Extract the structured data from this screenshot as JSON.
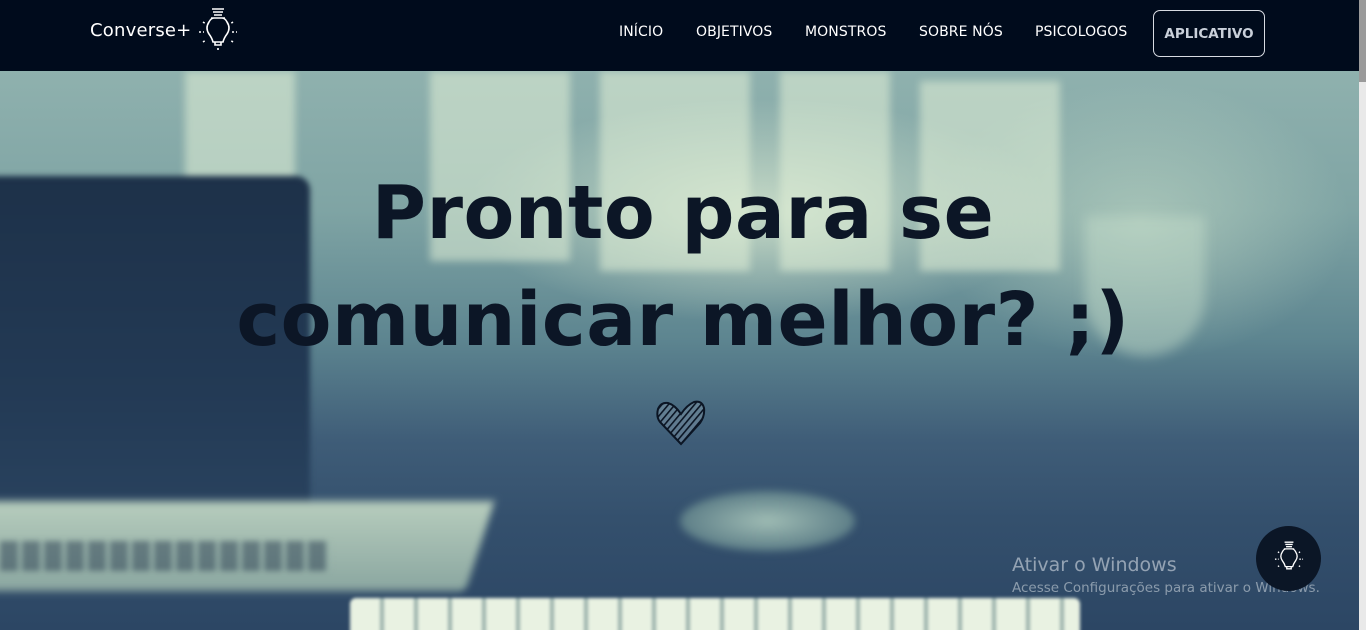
{
  "brand": {
    "name": "Converse+",
    "icon": "lightbulb-icon"
  },
  "nav": {
    "items": [
      {
        "label": "INÍCIO"
      },
      {
        "label": "OBJETIVOS"
      },
      {
        "label": "MONSTROS"
      },
      {
        "label": "SOBRE NÓS"
      },
      {
        "label": "PSICOLOGOS"
      }
    ],
    "cta_label": "APLICATIVO"
  },
  "hero": {
    "line1": "Pronto para se",
    "line2": "comunicar melhor? ;)",
    "decoration_icon": "heart-icon"
  },
  "floating_button": {
    "icon": "lightbulb-icon"
  },
  "watermark": {
    "title": "Ativar o Windows",
    "subtitle": "Acesse Configurações para ativar o Windows."
  },
  "colors": {
    "navbar_bg": "#000b1c",
    "headline": "#0c1626",
    "cta_border": "#d7dbe2"
  }
}
